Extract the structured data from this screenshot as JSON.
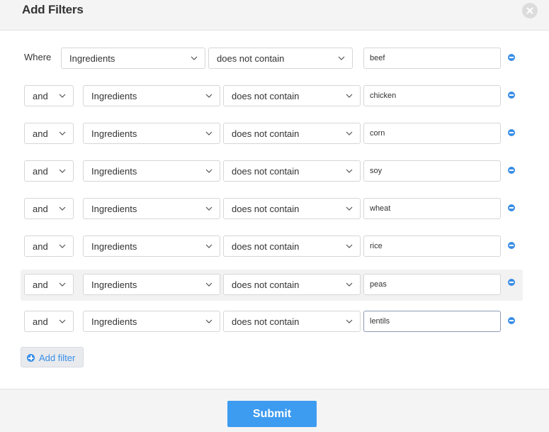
{
  "dialog": {
    "title": "Add Filters",
    "close_icon": "close-icon"
  },
  "filters": [
    {
      "connector": "Where",
      "field": "Ingredients",
      "operator": "does not contain",
      "value": "beef"
    },
    {
      "connector": "and",
      "field": "Ingredients",
      "operator": "does not contain",
      "value": "chicken"
    },
    {
      "connector": "and",
      "field": "Ingredients",
      "operator": "does not contain",
      "value": "corn"
    },
    {
      "connector": "and",
      "field": "Ingredients",
      "operator": "does not contain",
      "value": "soy"
    },
    {
      "connector": "and",
      "field": "Ingredients",
      "operator": "does not contain",
      "value": "wheat"
    },
    {
      "connector": "and",
      "field": "Ingredients",
      "operator": "does not contain",
      "value": "rice"
    },
    {
      "connector": "and",
      "field": "Ingredients",
      "operator": "does not contain",
      "value": "peas"
    },
    {
      "connector": "and",
      "field": "Ingredients",
      "operator": "does not contain",
      "value": "lentils"
    }
  ],
  "actions": {
    "add_filter_label": "Add filter",
    "submit_label": "Submit"
  },
  "colors": {
    "accent": "#3a8ee6",
    "submit": "#3d9bf0",
    "header_bg": "#f4f4f4"
  }
}
